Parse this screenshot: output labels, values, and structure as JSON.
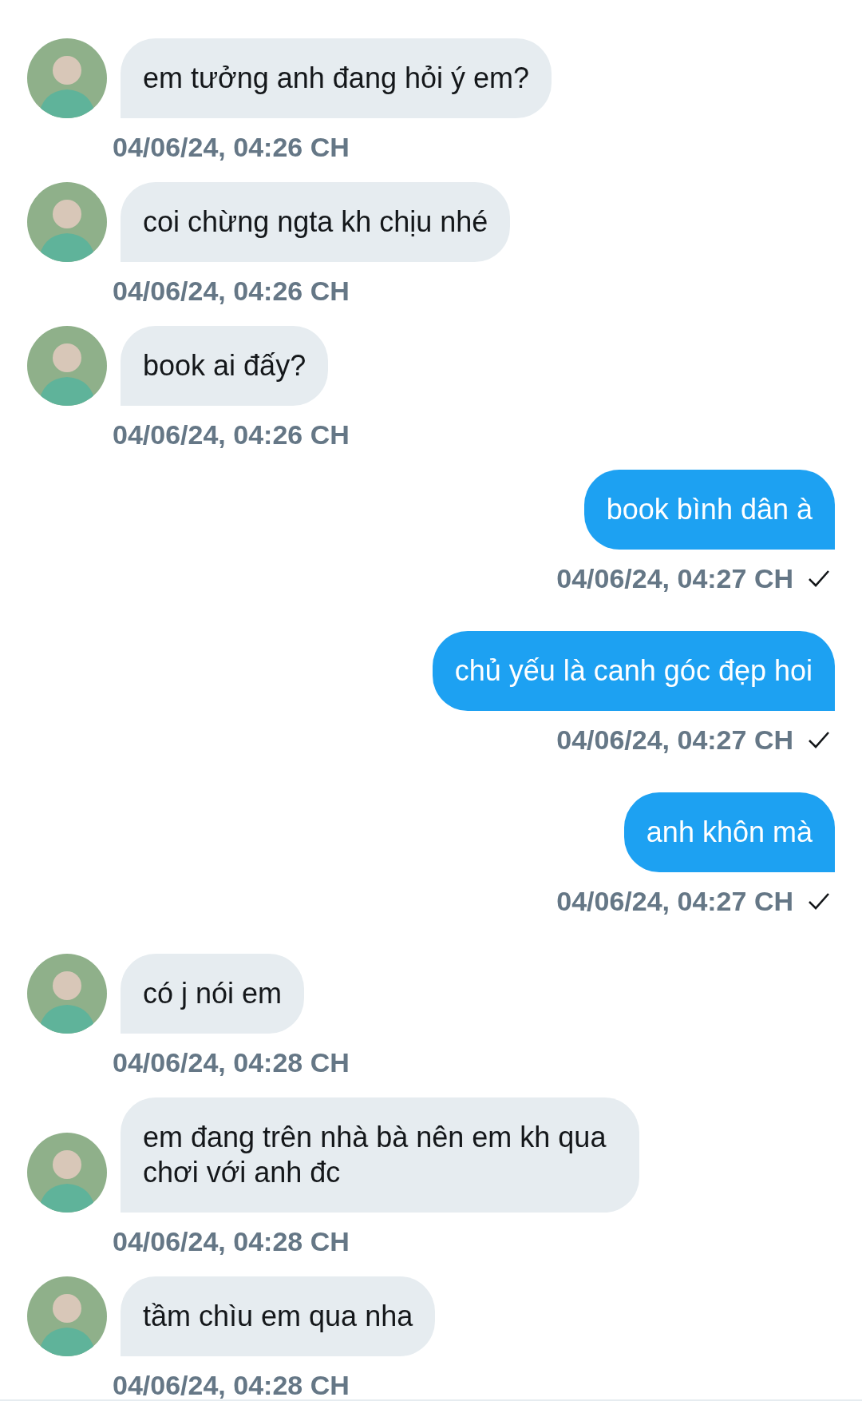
{
  "messages": [
    {
      "kind": "received",
      "text": "em tưởng anh đang hỏi ý em?",
      "time": "04/06/24, 04:26 CH"
    },
    {
      "kind": "received",
      "text": "coi chừng ngta kh chịu nhé",
      "time": "04/06/24, 04:26 CH"
    },
    {
      "kind": "received",
      "text": "book ai đấy?",
      "time": "04/06/24, 04:26 CH"
    },
    {
      "kind": "sent",
      "text": "book bình dân à",
      "time": "04/06/24, 04:27 CH",
      "delivered": true
    },
    {
      "kind": "sent",
      "text": "chủ yếu là canh góc đẹp hoi",
      "time": "04/06/24, 04:27 CH",
      "delivered": true
    },
    {
      "kind": "sent",
      "text": "anh khôn mà",
      "time": "04/06/24, 04:27 CH",
      "delivered": true
    },
    {
      "kind": "received",
      "text": "có j nói em",
      "time": "04/06/24, 04:28 CH"
    },
    {
      "kind": "received",
      "text": "em đang trên nhà bà nên em kh qua chơi với anh đc",
      "time": "04/06/24, 04:28 CH"
    },
    {
      "kind": "received",
      "text": "tầm chìu em qua nha",
      "time": "04/06/24, 04:28 CH"
    }
  ]
}
